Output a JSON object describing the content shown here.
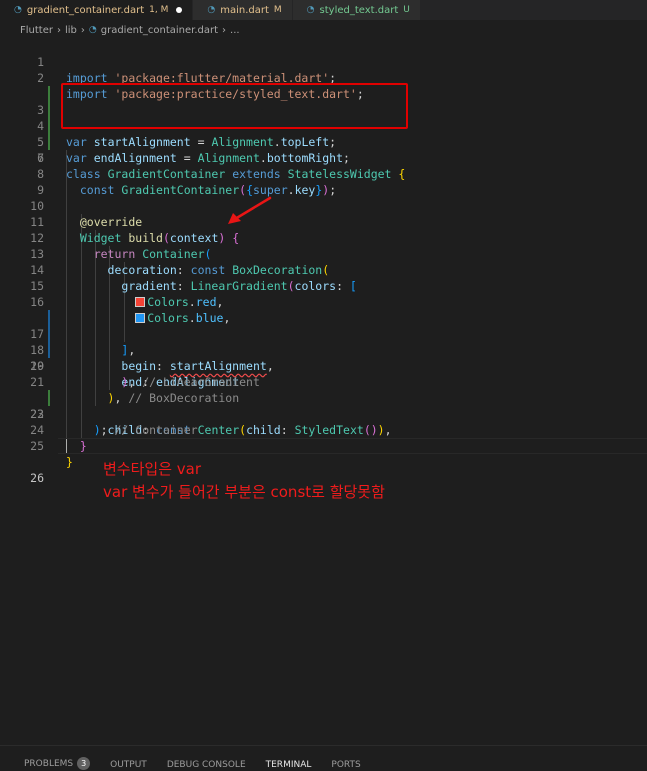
{
  "tabs": [
    {
      "label": "gradient_container.dart",
      "status": "1, M",
      "modified_dot": true,
      "active": true
    },
    {
      "label": "main.dart",
      "status": "M",
      "active": false
    },
    {
      "label": "styled_text.dart",
      "status": "U",
      "active": false
    }
  ],
  "breadcrumb": [
    "Flutter",
    "lib",
    "gradient_container.dart",
    "..."
  ],
  "code": {
    "l2_import": "import",
    "l1_str": "'package:flutter/material.dart'",
    "l2_str": "'package:practice/styled_text.dart'",
    "var_kw": "var",
    "start_name": "startAlignment",
    "end_name": "endAlignment",
    "alignment_type": "Alignment",
    "top_left": "topLeft",
    "bottom_right": "bottomRight",
    "class_kw": "class",
    "class_name": "GradientContainer",
    "extends_kw": "extends",
    "base_class": "StatelessWidget",
    "const_kw": "const",
    "super_kw": "super",
    "key_word": "key",
    "override": "@override",
    "widget": "Widget",
    "build": "build",
    "context": "context",
    "return_kw": "return",
    "container": "Container",
    "decoration": "decoration",
    "box_decoration": "BoxDecoration",
    "gradient": "gradient",
    "linear_gradient": "LinearGradient",
    "colors": "colors",
    "colors_class": "Colors",
    "red": "red",
    "blue": "blue",
    "begin": "begin",
    "end": "end",
    "child": "child",
    "center": "Center",
    "styled_text": "StyledText",
    "cmt_linear": "// LinearGradient",
    "cmt_box": "// BoxDecoration",
    "cmt_container": "// Container"
  },
  "line_numbers": [
    "1",
    "2",
    "3",
    "4",
    "5",
    "6",
    "7",
    "8",
    "9",
    "10",
    "11",
    "12",
    "13",
    "14",
    "15",
    "16",
    "17",
    "18",
    "19",
    "20",
    "21",
    "22",
    "23",
    "24",
    "25",
    "26"
  ],
  "annotation": {
    "line1": "변수타입은 var",
    "line2": "var 변수가 들어간 부분은 const로 할당못함"
  },
  "panel": {
    "tabs": [
      "PROBLEMS",
      "OUTPUT",
      "DEBUG CONSOLE",
      "TERMINAL",
      "PORTS"
    ],
    "problems_count": "3",
    "active": "TERMINAL"
  },
  "colors": {
    "red_swatch": "#f44336",
    "blue_swatch": "#2196f3",
    "highlight_box": "#e00000",
    "annotation_text": "#f01c1c"
  }
}
